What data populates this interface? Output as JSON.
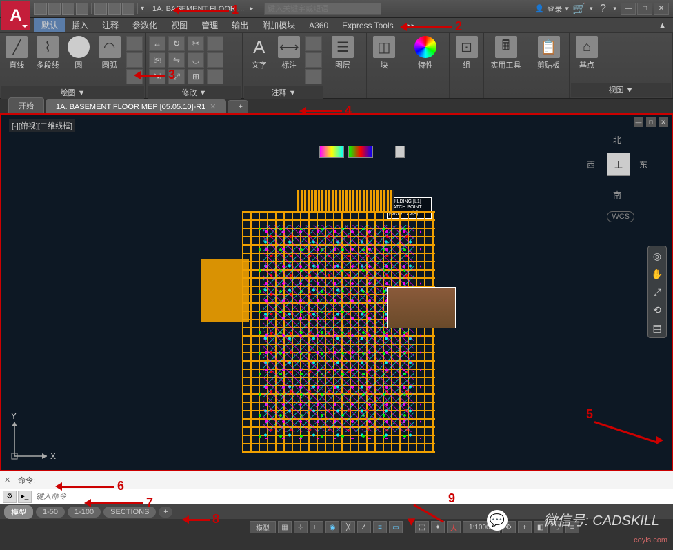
{
  "app": {
    "logo": "A"
  },
  "title": {
    "doc": "1A. BASEMENT FLOOR ...",
    "search_placeholder": "键入关键字或短语",
    "login": "登录"
  },
  "menu": {
    "items": [
      "默认",
      "插入",
      "注释",
      "参数化",
      "视图",
      "管理",
      "输出",
      "附加模块",
      "A360",
      "Express Tools"
    ]
  },
  "ribbon": {
    "panels": [
      {
        "title": "绘图 ▼",
        "buttons": [
          "直线",
          "多段线",
          "圆",
          "圆弧"
        ]
      },
      {
        "title": "修改 ▼"
      },
      {
        "title": "注释 ▼",
        "buttons": [
          "文字",
          "标注"
        ]
      },
      {
        "title": "",
        "buttons": [
          "图层"
        ]
      },
      {
        "title": "",
        "buttons": [
          "块"
        ]
      },
      {
        "title": "",
        "buttons": [
          "特性"
        ]
      },
      {
        "title": "",
        "buttons": [
          "组"
        ]
      },
      {
        "title": "",
        "buttons": [
          "实用工具"
        ]
      },
      {
        "title": "",
        "buttons": [
          "剪贴板"
        ]
      },
      {
        "title": "视图 ▼",
        "buttons": [
          "基点"
        ]
      }
    ]
  },
  "file_tabs": {
    "items": [
      {
        "label": "开始",
        "active": false
      },
      {
        "label": "1A. BASEMENT FLOOR MEP [05.05.10]-R1",
        "active": true
      }
    ]
  },
  "viewport": {
    "label": "[-][俯视][二维线框]",
    "viewcube": {
      "face": "上",
      "n": "北",
      "s": "南",
      "e": "东",
      "w": "西"
    },
    "wcs": "WCS",
    "ucs": {
      "x": "X",
      "y": "Y"
    },
    "callout": {
      "line1": "BUILDING [L1]",
      "line2": "MATCH POINT",
      "line3": "[GRID - 29/A]"
    }
  },
  "command": {
    "history_label": "命令:",
    "input_placeholder": "键入命令"
  },
  "layout_tabs": {
    "items": [
      "模型",
      "1-50",
      "1-100",
      "SECTIONS"
    ]
  },
  "status": {
    "model": "模型",
    "scale": "1:1000"
  },
  "annotations": {
    "a1": "1",
    "a2": "2",
    "a3": "3",
    "a4": "4",
    "a5": "5",
    "a6": "6",
    "a7": "7",
    "a8": "8",
    "a9": "9"
  },
  "watermark": {
    "text": "微信号: CADSKILL",
    "corner": "coyis.com"
  }
}
